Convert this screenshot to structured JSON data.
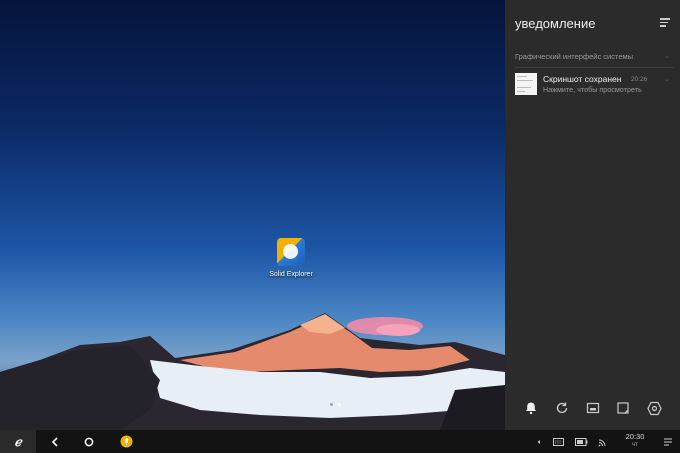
{
  "desktop": {
    "app": {
      "label": "Solid Explorer",
      "icon": "solid-explorer-icon"
    }
  },
  "notifications": {
    "title": "уведомление",
    "menu_icon": "clear-all-icon",
    "section": "Графический интерфейс системы",
    "item": {
      "title": "Скриншот сохранен",
      "time": "20:26",
      "subtitle": "Нажмите, чтобы просмотреть"
    },
    "quick_settings": [
      "bell-icon",
      "rotate-icon",
      "display-icon",
      "window-icon",
      "settings-icon"
    ]
  },
  "taskbar": {
    "start_label": "ℯ",
    "clock": {
      "time": "20:30",
      "day": "чт"
    },
    "colors": {
      "accent": "#f0b400",
      "bar": "#131313"
    }
  }
}
